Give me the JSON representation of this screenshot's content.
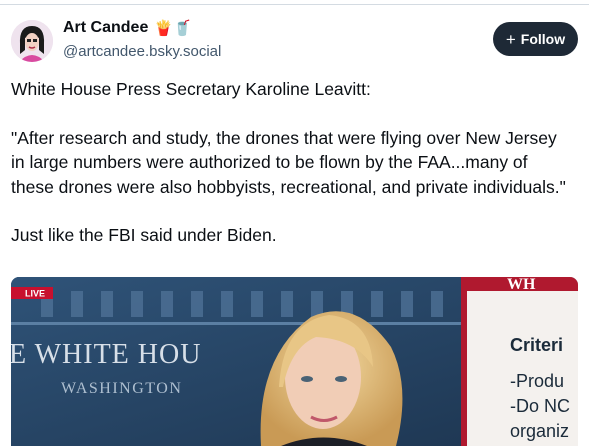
{
  "author": {
    "display_name": "Art Candee",
    "emojis": "🍟🥤",
    "handle": "@artcandee.bsky.social"
  },
  "follow_button": {
    "icon": "plus-icon",
    "label": "Follow"
  },
  "post": {
    "line1": "White House Press Secretary Karoline Leavitt:",
    "quote": "\"After research and study, the drones that were flying over New Jersey in large numbers were authorized to be flown by the FAA...many of these drones were also hobbyists, recreational, and private individuals.\"",
    "line3": "Just like the FBI said under Biden."
  },
  "media": {
    "live_badge": "LIVE",
    "backdrop_title": "E WHITE HOU",
    "backdrop_subtitle": "WASHINGTON",
    "graphic_header": "WH",
    "graphic_title": "Criteri",
    "graphic_lines": [
      "-Produ",
      "-Do NC",
      "organiz"
    ]
  },
  "colors": {
    "follow_bg": "#1e2936",
    "live_red": "#c8102e",
    "handle_gray": "#42576c"
  }
}
